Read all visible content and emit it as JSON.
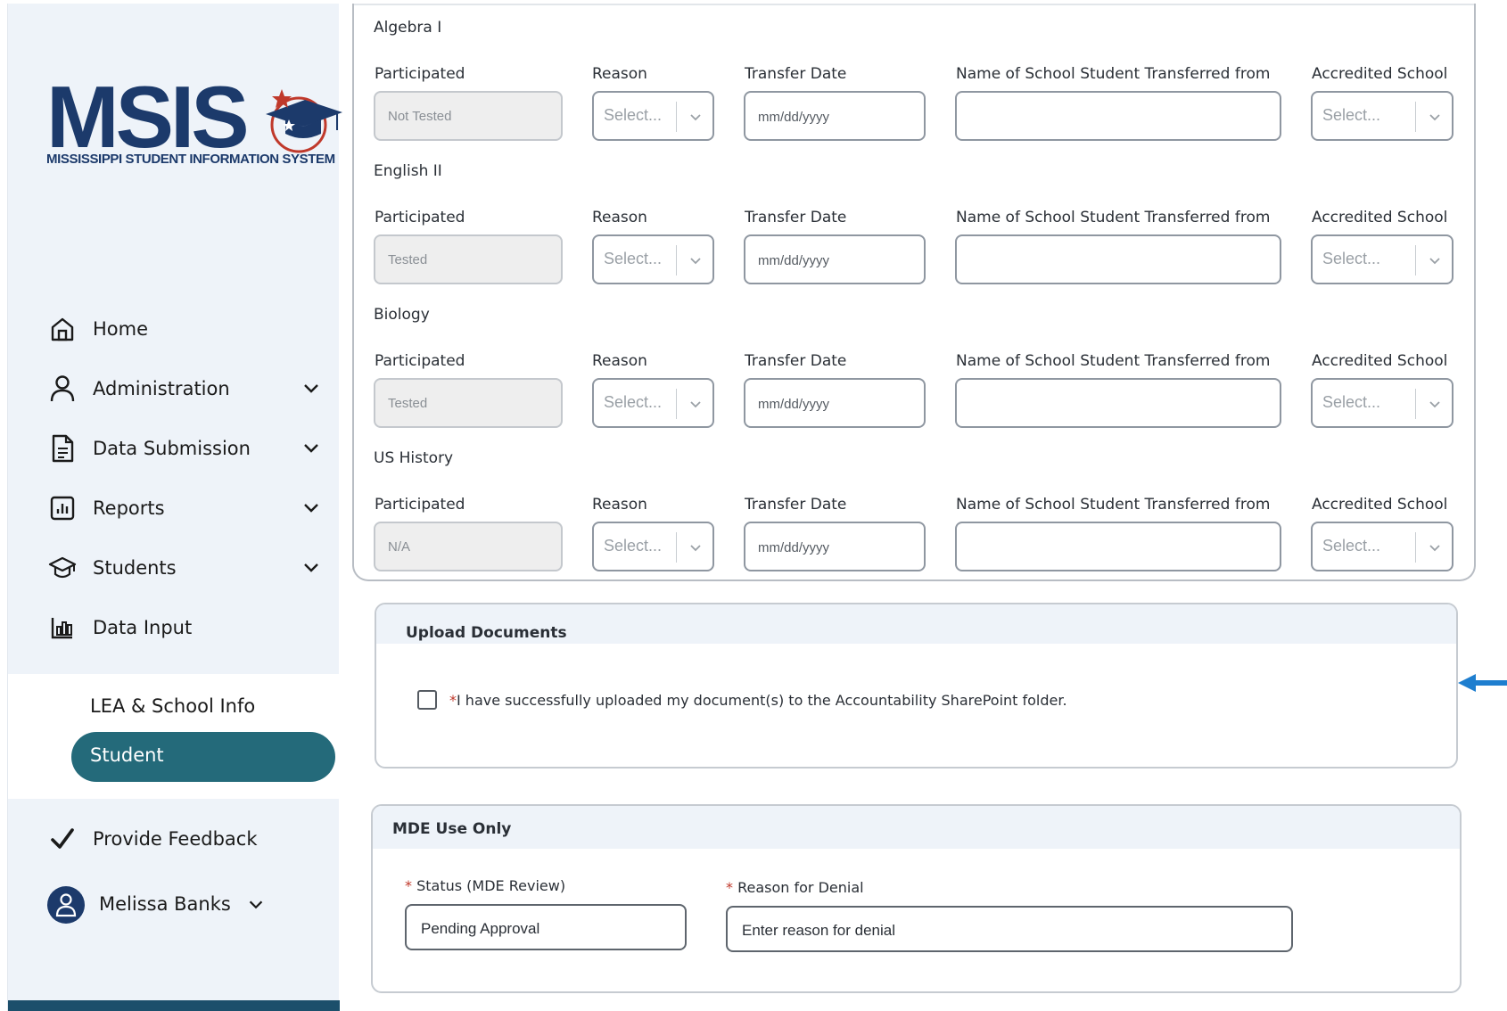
{
  "logo": {
    "word": "MSIS",
    "subtitle": "MISSISSIPPI STUDENT INFORMATION SYSTEM"
  },
  "nav": [
    {
      "label": "Home",
      "icon": "home-icon",
      "has_chevron": false
    },
    {
      "label": "Administration",
      "icon": "user-icon",
      "has_chevron": true
    },
    {
      "label": "Data Submission",
      "icon": "document-icon",
      "has_chevron": true
    },
    {
      "label": "Reports",
      "icon": "bar-chart-icon",
      "has_chevron": true
    },
    {
      "label": "Students",
      "icon": "graduation-cap-icon",
      "has_chevron": true
    },
    {
      "label": "Data Input",
      "icon": "data-input-icon",
      "has_chevron": false
    }
  ],
  "subnav": {
    "lea": "LEA & School Info",
    "student": "Student"
  },
  "feedback": "Provide Feedback",
  "user": {
    "name": "Melissa Banks"
  },
  "columns": {
    "participated": "Participated",
    "reason": "Reason",
    "transfer_date": "Transfer Date",
    "school_from": "Name of School Student Transferred from",
    "accredited": "Accredited School"
  },
  "placeholders": {
    "select": "Select...",
    "date": "mm/dd/yyyy"
  },
  "subjects": [
    {
      "name": "Algebra I",
      "participated": "Not Tested"
    },
    {
      "name": "English II",
      "participated": "Tested"
    },
    {
      "name": "Biology",
      "participated": "Tested"
    },
    {
      "name": "US History",
      "participated": "N/A"
    }
  ],
  "upload": {
    "title": "Upload Documents",
    "required_mark": "*",
    "checkbox_label": "I have successfully uploaded my document(s) to the Accountability SharePoint folder."
  },
  "mde": {
    "title": "MDE Use Only",
    "status_label": "Status (MDE Review)",
    "status_value": "Pending Approval",
    "denial_label": "Reason for Denial",
    "denial_placeholder": "Enter reason for denial",
    "required_mark": "*"
  },
  "colors": {
    "primary": "#1c3a6b",
    "active": "#246a7a",
    "accent_red": "#c0392b",
    "arrow": "#1e7ecf"
  }
}
